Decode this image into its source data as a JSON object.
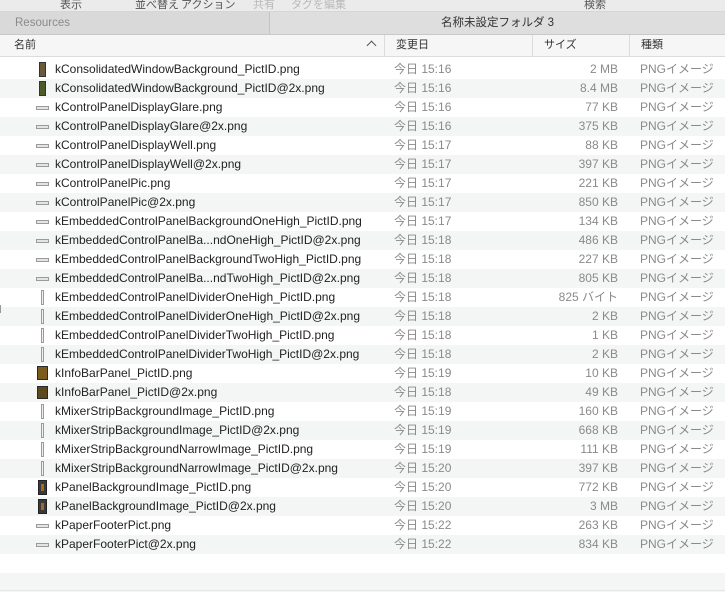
{
  "toolbar": {
    "items": [
      "表示",
      "並べ替え",
      "アクション",
      "共有",
      "タグを編集",
      "検索"
    ]
  },
  "tabs": {
    "left": "Resources",
    "right": "名称未設定フォルダ 3"
  },
  "columns": {
    "name": "名前",
    "date": "変更日",
    "size": "サイズ",
    "kind": "種類"
  },
  "files": [
    {
      "name": "kConsolidatedWindowBackground_PictID.png",
      "date": "今日 15:16",
      "size": "2 MB",
      "kind": "PNGイメージ",
      "icon": "tall-image-icon"
    },
    {
      "name": "kConsolidatedWindowBackground_PictID@2x.png",
      "date": "今日 15:16",
      "size": "8.4 MB",
      "kind": "PNGイメージ",
      "icon": "tall-image-icon"
    },
    {
      "name": "kControlPanelDisplayGlare.png",
      "date": "今日 15:16",
      "size": "77 KB",
      "kind": "PNGイメージ",
      "icon": "bar-image-icon"
    },
    {
      "name": "kControlPanelDisplayGlare@2x.png",
      "date": "今日 15:16",
      "size": "375 KB",
      "kind": "PNGイメージ",
      "icon": "bar-image-icon"
    },
    {
      "name": "kControlPanelDisplayWell.png",
      "date": "今日 15:17",
      "size": "88 KB",
      "kind": "PNGイメージ",
      "icon": "bar-image-icon"
    },
    {
      "name": "kControlPanelDisplayWell@2x.png",
      "date": "今日 15:17",
      "size": "397 KB",
      "kind": "PNGイメージ",
      "icon": "bar-image-icon"
    },
    {
      "name": "kControlPanelPic.png",
      "date": "今日 15:17",
      "size": "221 KB",
      "kind": "PNGイメージ",
      "icon": "bar-image-icon"
    },
    {
      "name": "kControlPanelPic@2x.png",
      "date": "今日 15:17",
      "size": "850 KB",
      "kind": "PNGイメージ",
      "icon": "bar-image-icon"
    },
    {
      "name": "kEmbeddedControlPanelBackgroundOneHigh_PictID.png",
      "date": "今日 15:17",
      "size": "134 KB",
      "kind": "PNGイメージ",
      "icon": "bar-image-icon"
    },
    {
      "name": "kEmbeddedControlPanelBa...ndOneHigh_PictID@2x.png",
      "date": "今日 15:18",
      "size": "486 KB",
      "kind": "PNGイメージ",
      "icon": "bar-image-icon"
    },
    {
      "name": "kEmbeddedControlPanelBackgroundTwoHigh_PictID.png",
      "date": "今日 15:18",
      "size": "227 KB",
      "kind": "PNGイメージ",
      "icon": "bar-image-icon"
    },
    {
      "name": "kEmbeddedControlPanelBa...ndTwoHigh_PictID@2x.png",
      "date": "今日 15:18",
      "size": "805 KB",
      "kind": "PNGイメージ",
      "icon": "bar-image-icon"
    },
    {
      "name": "kEmbeddedControlPanelDividerOneHigh_PictID.png",
      "date": "今日 15:18",
      "size": "825 バイト",
      "kind": "PNGイメージ",
      "icon": "thin-image-icon"
    },
    {
      "name": "kEmbeddedControlPanelDividerOneHigh_PictID@2x.png",
      "date": "今日 15:18",
      "size": "2 KB",
      "kind": "PNGイメージ",
      "icon": "thin-image-icon"
    },
    {
      "name": "kEmbeddedControlPanelDividerTwoHigh_PictID.png",
      "date": "今日 15:18",
      "size": "1 KB",
      "kind": "PNGイメージ",
      "icon": "thin-image-icon"
    },
    {
      "name": "kEmbeddedControlPanelDividerTwoHigh_PictID@2x.png",
      "date": "今日 15:18",
      "size": "2 KB",
      "kind": "PNGイメージ",
      "icon": "thin-image-icon"
    },
    {
      "name": "kInfoBarPanel_PictID.png",
      "date": "今日 15:19",
      "size": "10 KB",
      "kind": "PNGイメージ",
      "icon": "square-image-icon"
    },
    {
      "name": "kInfoBarPanel_PictID@2x.png",
      "date": "今日 15:18",
      "size": "49 KB",
      "kind": "PNGイメージ",
      "icon": "square-image-icon"
    },
    {
      "name": "kMixerStripBackgroundImage_PictID.png",
      "date": "今日 15:19",
      "size": "160 KB",
      "kind": "PNGイメージ",
      "icon": "thin-image-icon"
    },
    {
      "name": "kMixerStripBackgroundImage_PictID@2x.png",
      "date": "今日 15:19",
      "size": "668 KB",
      "kind": "PNGイメージ",
      "icon": "thin-image-icon"
    },
    {
      "name": "kMixerStripBackgroundNarrowImage_PictID.png",
      "date": "今日 15:19",
      "size": "111 KB",
      "kind": "PNGイメージ",
      "icon": "thin-image-icon"
    },
    {
      "name": "kMixerStripBackgroundNarrowImage_PictID@2x.png",
      "date": "今日 15:20",
      "size": "397 KB",
      "kind": "PNGイメージ",
      "icon": "thin-image-icon"
    },
    {
      "name": "kPanelBackgroundImage_PictID.png",
      "date": "今日 15:20",
      "size": "772 KB",
      "kind": "PNGイメージ",
      "icon": "panel-image-icon"
    },
    {
      "name": "kPanelBackgroundImage_PictID@2x.png",
      "date": "今日 15:20",
      "size": "3 MB",
      "kind": "PNGイメージ",
      "icon": "panel-image-icon"
    },
    {
      "name": "kPaperFooterPict.png",
      "date": "今日 15:22",
      "size": "263 KB",
      "kind": "PNGイメージ",
      "icon": "bar-image-icon"
    },
    {
      "name": "kPaperFooterPict@2x.png",
      "date": "今日 15:22",
      "size": "834 KB",
      "kind": "PNGイメージ",
      "icon": "bar-image-icon"
    }
  ]
}
